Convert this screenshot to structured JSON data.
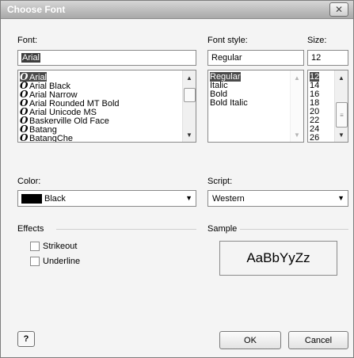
{
  "dialog": {
    "title": "Choose Font",
    "close_glyph": "✕"
  },
  "font": {
    "label": "Font:",
    "value": "Arial",
    "items": [
      "Arial",
      "Arial Black",
      "Arial Narrow",
      "Arial Rounded MT Bold",
      "Arial Unicode MS",
      "Baskerville Old Face",
      "Batang",
      "BatangChe"
    ],
    "selected": "Arial"
  },
  "font_style": {
    "label": "Font style:",
    "value": "Regular",
    "items": [
      "Regular",
      "Italic",
      "Bold",
      "Bold Italic"
    ],
    "selected": "Regular"
  },
  "size": {
    "label": "Size:",
    "value": "12",
    "items": [
      "12",
      "14",
      "16",
      "18",
      "20",
      "22",
      "24",
      "26"
    ],
    "selected": "12"
  },
  "color": {
    "label": "Color:",
    "value": "Black",
    "swatch": "#000000"
  },
  "script": {
    "label": "Script:",
    "value": "Western"
  },
  "effects": {
    "label": "Effects",
    "strikeout": "Strikeout",
    "underline": "Underline"
  },
  "sample": {
    "label": "Sample",
    "text": "AaBbYyZz"
  },
  "buttons": {
    "help": "?",
    "ok": "OK",
    "cancel": "Cancel"
  }
}
